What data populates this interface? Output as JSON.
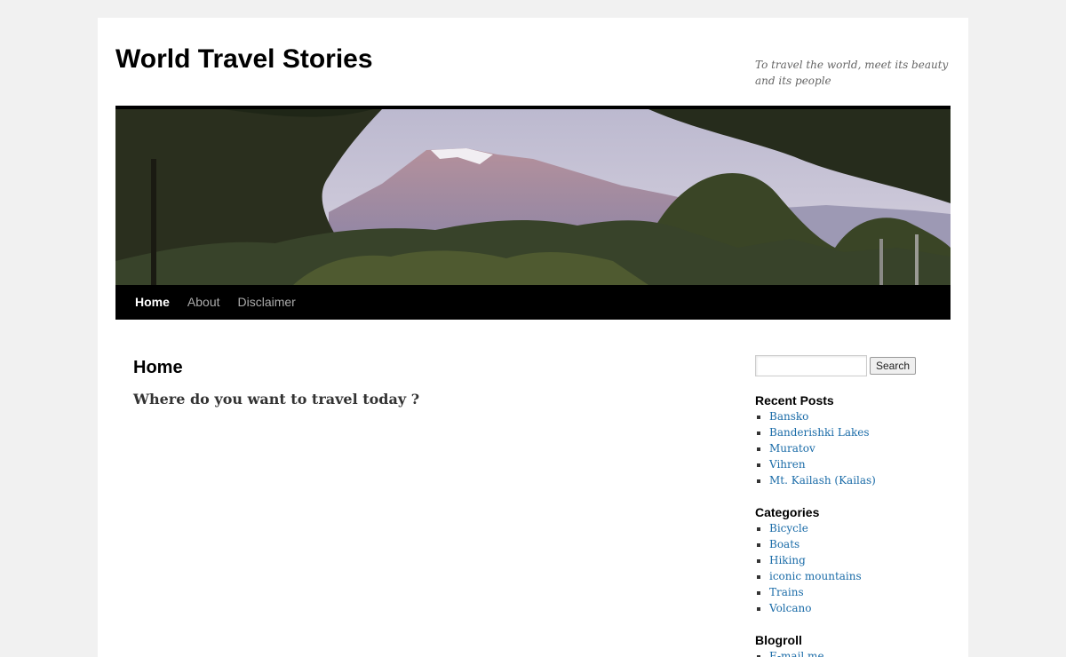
{
  "site": {
    "title": "World Travel Stories",
    "description": "To travel the world, meet its beauty and its people"
  },
  "nav": {
    "items": [
      "Home",
      "About",
      "Disclaimer"
    ],
    "current": "Home"
  },
  "content": {
    "heading": "Home",
    "subheading": "Where do you want to travel today ?"
  },
  "sidebar": {
    "search": {
      "value": "",
      "button_label": "Search"
    },
    "recent_posts": {
      "title": "Recent Posts",
      "items": [
        "Bansko",
        "Banderishki Lakes",
        "Muratov",
        "Vihren",
        "Mt. Kailash (Kailas)"
      ]
    },
    "categories": {
      "title": "Categories",
      "items": [
        "Bicycle",
        "Boats",
        "Hiking",
        "iconic mountains",
        "Trains",
        "Volcano"
      ]
    },
    "blogroll": {
      "title": "Blogroll",
      "items": [
        "E-mail me"
      ]
    }
  },
  "colors": {
    "link": "#1b6ca8",
    "nav_background": "#000000",
    "page_background": "#f1f1f1"
  }
}
